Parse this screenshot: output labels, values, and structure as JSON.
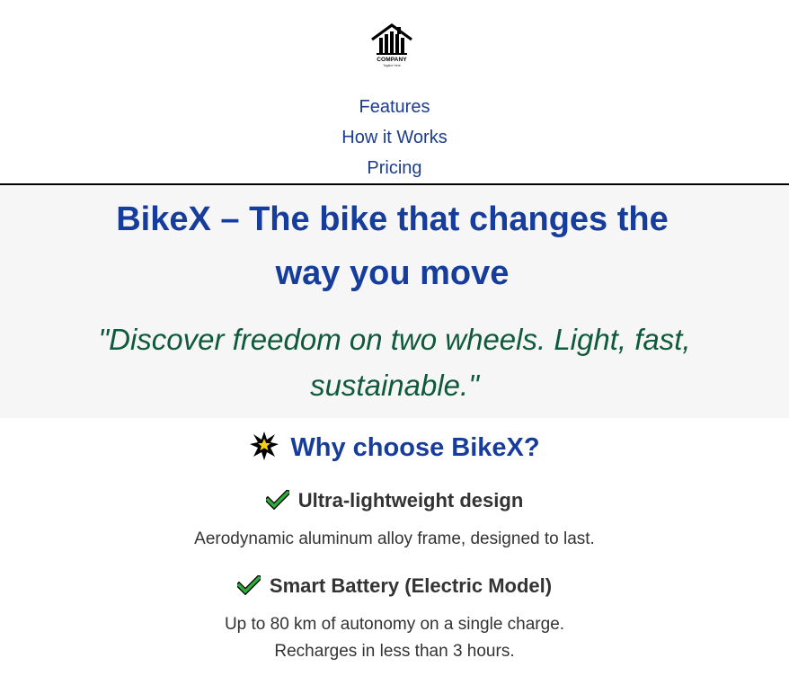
{
  "header": {
    "logo_text": "COMPANY",
    "logo_tagline": "Tagline Here",
    "nav": [
      {
        "label": "Features"
      },
      {
        "label": "How it Works"
      },
      {
        "label": "Pricing"
      }
    ]
  },
  "hero": {
    "title": "BikeX – The bike that changes the way you move",
    "quote": "\"Discover freedom on two wheels. Light, fast, sustainable.\""
  },
  "features": {
    "title": "Why choose BikeX?",
    "title_icon": "glowing-star-icon",
    "items": [
      {
        "icon": "check-mark-icon",
        "title": "Ultra-lightweight design",
        "lines": [
          "Aerodynamic aluminum alloy frame, designed to last."
        ]
      },
      {
        "icon": "check-mark-icon",
        "title": "Smart Battery (Electric Model)",
        "lines": [
          "Up to 80 km of autonomy on a single charge.",
          "Recharges in less than 3 hours."
        ]
      }
    ]
  },
  "colors": {
    "link": "#1c3d8f",
    "heading": "#163d9c",
    "quote": "#0f5a3c",
    "body_text": "#333333",
    "hero_bg": "#f6f6f6",
    "check": "#2fae3a",
    "star": "#f5d20c"
  }
}
